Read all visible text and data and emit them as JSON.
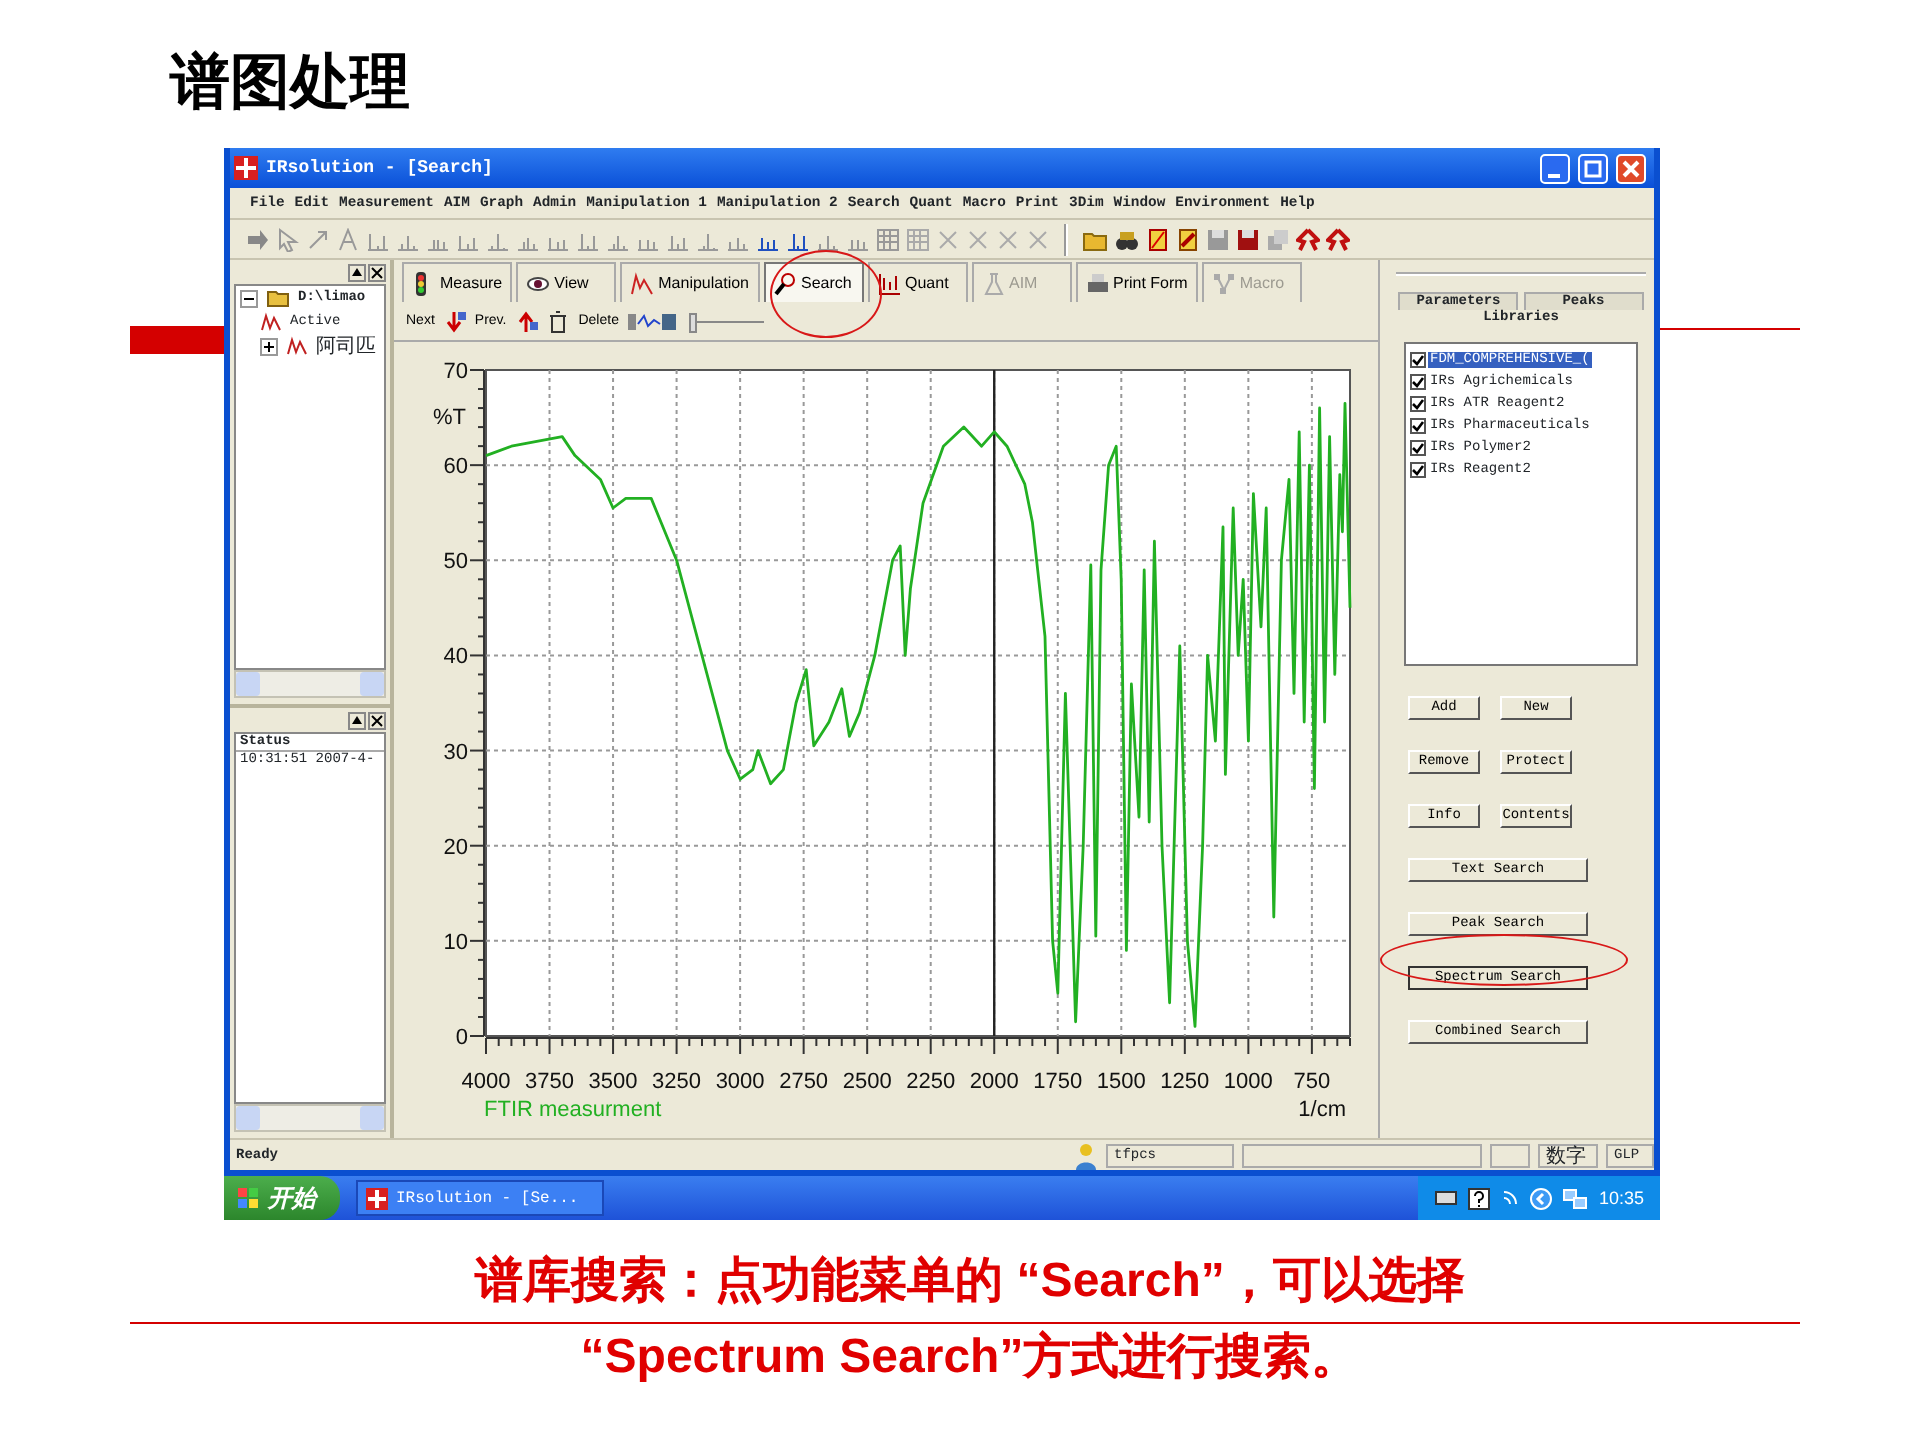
{
  "slide": {
    "title": "谱图处理",
    "caption": [
      "谱库搜索：点功能菜单的 “Search”，可以选择",
      "“Spectrum Search”方式进行搜索。"
    ]
  },
  "window": {
    "title": "IRsolution - [Search]"
  },
  "menu": [
    "File",
    "Edit",
    "Measurement",
    "AIM",
    "Graph",
    "Admin",
    "Manipulation 1",
    "Manipulation 2",
    "Search",
    "Quant",
    "Macro",
    "Print",
    "3Dim",
    "Window",
    "Environment",
    "Help"
  ],
  "tabs": [
    {
      "label": "Measure",
      "selected": false,
      "disabled": false,
      "highlighted": false
    },
    {
      "label": "View",
      "selected": false,
      "disabled": false,
      "highlighted": false
    },
    {
      "label": "Manipulation",
      "selected": false,
      "disabled": false,
      "highlighted": false
    },
    {
      "label": "Search",
      "selected": true,
      "disabled": false,
      "highlighted": true
    },
    {
      "label": "Quant",
      "selected": false,
      "disabled": false,
      "highlighted": false
    },
    {
      "label": "AIM",
      "selected": false,
      "disabled": true,
      "highlighted": false
    },
    {
      "label": "Print Form",
      "selected": false,
      "disabled": false,
      "highlighted": false
    },
    {
      "label": "Macro",
      "selected": false,
      "disabled": true,
      "highlighted": false
    }
  ],
  "tree": [
    {
      "label": "D:\\limao",
      "expanded": true,
      "children": [
        {
          "label": "Active"
        },
        {
          "label": "阿司匹",
          "expanded": false
        }
      ]
    }
  ],
  "status_panel": {
    "header": "Status",
    "lines": [
      "10:31:51 2007-4-"
    ]
  },
  "spectrum_toolbar": [
    "Next",
    "Prev.",
    "Delete"
  ],
  "chart": {
    "chart_data": {
      "type": "line",
      "xlabel": "1/cm",
      "ylabel": "%T",
      "x": [
        4000,
        3900,
        3800,
        3700,
        3650,
        3550,
        3500,
        3450,
        3350,
        3250,
        3150,
        3050,
        3000,
        2950,
        2930,
        2880,
        2830,
        2780,
        2740,
        2710,
        2650,
        2600,
        2570,
        2530,
        2470,
        2400,
        2370,
        2350,
        2330,
        2280,
        2200,
        2120,
        2050,
        2000,
        1950,
        1880,
        1850,
        1800,
        1770,
        1750,
        1720,
        1680,
        1650,
        1620,
        1600,
        1580,
        1550,
        1520,
        1500,
        1480,
        1460,
        1430,
        1410,
        1390,
        1370,
        1340,
        1310,
        1270,
        1240,
        1210,
        1180,
        1160,
        1130,
        1100,
        1090,
        1060,
        1040,
        1020,
        1000,
        980,
        950,
        930,
        900,
        870,
        840,
        820,
        800,
        780,
        760,
        740,
        720,
        700,
        680,
        660,
        640,
        630,
        620,
        600
      ],
      "series": [
        {
          "name": "FTIR measurment",
          "color": "#22b022",
          "values": [
            61,
            62,
            62.5,
            63,
            61,
            58.5,
            55.5,
            56.5,
            56.5,
            50,
            40,
            30,
            27,
            28,
            30,
            26.5,
            28,
            35,
            38.5,
            30.5,
            33,
            36.5,
            31.5,
            34,
            40,
            50,
            51.5,
            40,
            47,
            56,
            62,
            64,
            62,
            63.5,
            62,
            58,
            54,
            42,
            10,
            4.5,
            36,
            1.5,
            20,
            49.5,
            10.5,
            49,
            60,
            62,
            48,
            9,
            37,
            23,
            49,
            22.5,
            52,
            20,
            3.5,
            41,
            10,
            1,
            20,
            40,
            31,
            53.5,
            27.5,
            55.5,
            40,
            48,
            31,
            57,
            43,
            55.5,
            12.5,
            50,
            58.5,
            36,
            63.5,
            33,
            60,
            26,
            66,
            33,
            63,
            38,
            59,
            53,
            66.5,
            45
          ]
        }
      ],
      "xlim": [
        4000,
        600
      ],
      "ylim": [
        0,
        70
      ],
      "xticks": [
        4000,
        3750,
        3500,
        3250,
        3000,
        2750,
        2500,
        2250,
        2000,
        1750,
        1500,
        1250,
        1000,
        750
      ],
      "yticks": [
        0,
        10,
        20,
        30,
        40,
        50,
        60,
        70
      ],
      "grid": true,
      "ref_lines": [
        {
          "axis": "x",
          "value": 2000,
          "color": "#222222"
        }
      ]
    }
  },
  "right_panel": {
    "tabs": [
      {
        "label": "Parameters",
        "selected": false
      },
      {
        "label": "Peaks",
        "selected": false
      },
      {
        "label": "Libraries",
        "selected": true
      }
    ],
    "libraries": [
      {
        "label": "FDM_COMPREHENSIVE_(",
        "checked": true,
        "selected": true
      },
      {
        "label": "IRs Agrichemicals",
        "checked": true,
        "selected": false
      },
      {
        "label": "IRs ATR Reagent2",
        "checked": true,
        "selected": false
      },
      {
        "label": "IRs Pharmaceuticals",
        "checked": true,
        "selected": false
      },
      {
        "label": "IRs Polymer2",
        "checked": true,
        "selected": false
      },
      {
        "label": "IRs Reagent2",
        "checked": true,
        "selected": false
      }
    ],
    "buttons": [
      {
        "label": "Add",
        "kind": "half",
        "highlighted": false
      },
      {
        "label": "New",
        "kind": "half",
        "highlighted": false
      },
      {
        "label": "Remove",
        "kind": "half",
        "highlighted": false
      },
      {
        "label": "Protect",
        "kind": "half",
        "highlighted": false
      },
      {
        "label": "Info",
        "kind": "half",
        "highlighted": false
      },
      {
        "label": "Contents",
        "kind": "half",
        "highlighted": false
      },
      {
        "label": "Text Search",
        "kind": "wide",
        "highlighted": false
      },
      {
        "label": "Peak Search",
        "kind": "wide",
        "highlighted": false
      },
      {
        "label": "Spectrum Search",
        "kind": "wide",
        "highlighted": true
      },
      {
        "label": "Combined Search",
        "kind": "wide",
        "highlighted": false
      }
    ]
  },
  "status_bar": {
    "text": "Ready",
    "user": "tfpcs",
    "indicators": [
      "数字",
      "GLP"
    ]
  },
  "taskbar": {
    "start": "开始",
    "tasks": [
      {
        "label": "IRsolution - [Se...",
        "selected": false
      }
    ],
    "clock": "10:35"
  }
}
